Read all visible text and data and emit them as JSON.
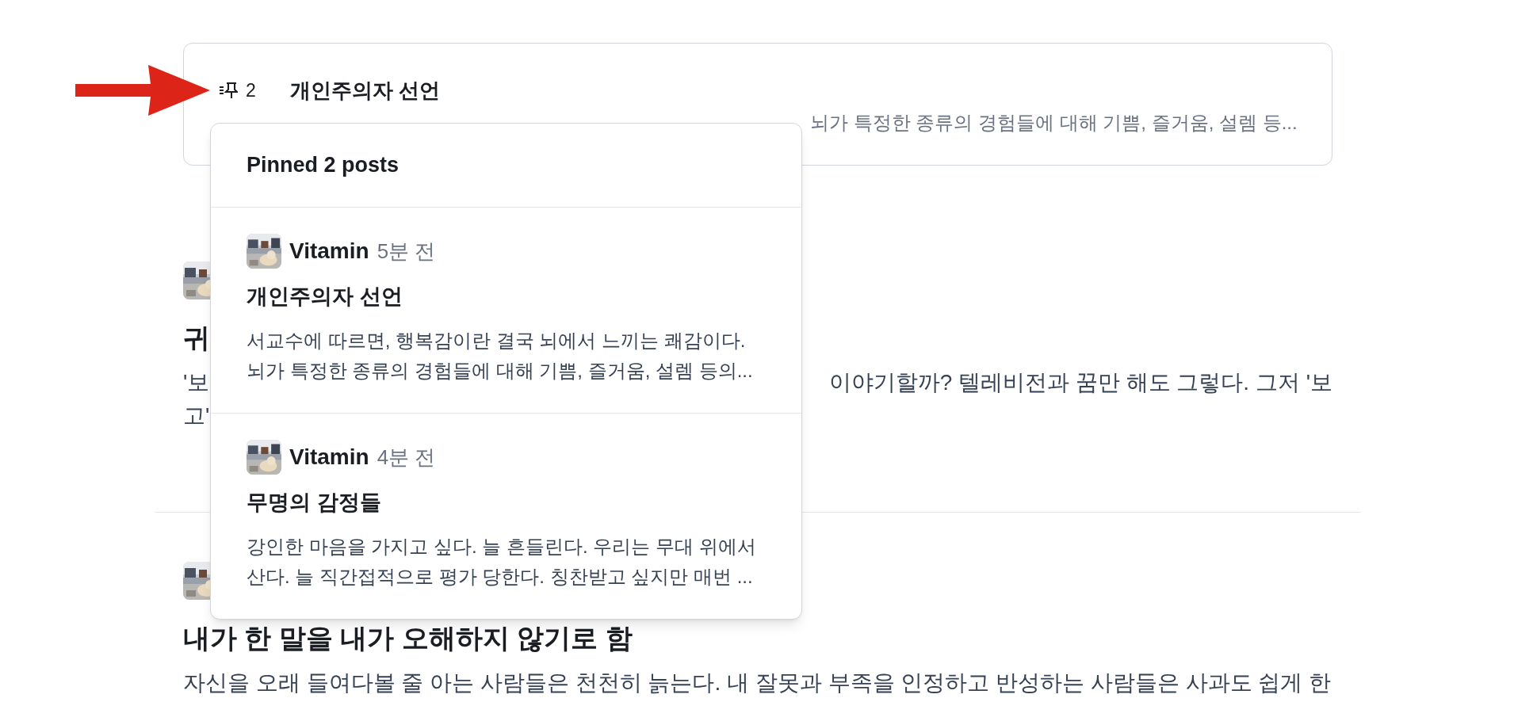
{
  "pinned_card": {
    "count": "2",
    "title": "개인주의자 선언",
    "excerpt": "뇌가 특정한 종류의 경험들에 대해 기쁨, 즐거움, 설렘 등..."
  },
  "feed": [
    {
      "title": "귀",
      "excerpt_lines": [
        [
          "'보",
          "이야기할까? 텔레비전과 꿈만 해도 그렇다. 그저 '보"
        ],
        [
          "고'"
        ]
      ]
    },
    {
      "title": "내가 한 말을 내가 오해하지 않기로 함",
      "excerpt_lines": [
        [
          "자신을 오래 들여다볼 줄 아는 사람들은 천천히 늙는다. 내 잘못과 부족을 인정하고 반성하는 사람들은 사과도 쉽게 한"
        ]
      ]
    }
  ],
  "popup": {
    "title": "Pinned 2 posts",
    "posts": [
      {
        "author": "Vitamin",
        "time": "5분 전",
        "title": "개인주의자 선언",
        "excerpt_lines": [
          "서교수에 따르면, 행복감이란 결국 뇌에서 느끼는 쾌감이다.",
          "뇌가 특정한 종류의 경험들에 대해 기쁨, 즐거움, 설렘 등의..."
        ]
      },
      {
        "author": "Vitamin",
        "time": "4분 전",
        "title": "무명의 감정들",
        "excerpt_lines": [
          "강인한 마음을 가지고 싶다. 늘 흔들린다. 우리는 무대 위에서",
          "산다. 늘 직간접적으로 평가 당한다. 칭찬받고 싶지만 매번 ..."
        ]
      }
    ]
  }
}
